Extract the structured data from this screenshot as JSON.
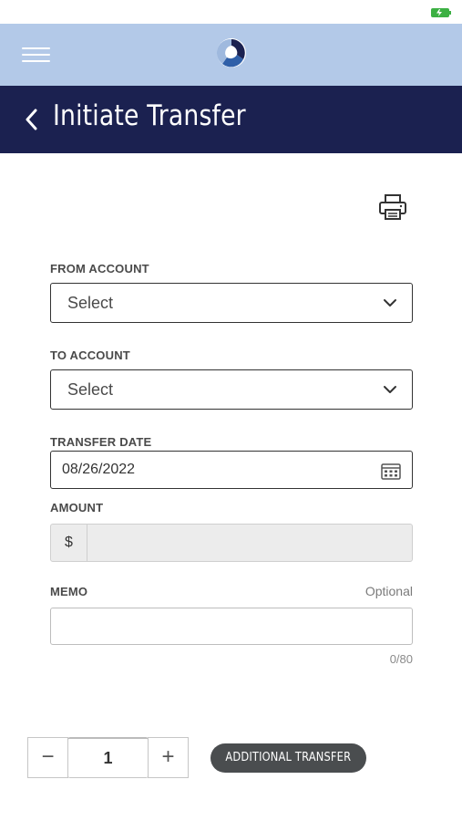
{
  "status_bar": {
    "battery_icon": "battery-icon",
    "accent_color": "#3cb043"
  },
  "app_bar": {
    "menu_icon": "hamburger-menu-icon",
    "logo_icon": "app-logo-icon",
    "background": "#b3c9e8"
  },
  "header": {
    "title": "Initiate Transfer",
    "back_icon": "chevron-left-icon",
    "background": "#1b2150"
  },
  "toolbar": {
    "print_icon": "printer-icon"
  },
  "form": {
    "from_account": {
      "label": "FROM ACCOUNT",
      "value": "Select"
    },
    "to_account": {
      "label": "TO ACCOUNT",
      "value": "Select"
    },
    "transfer_date": {
      "label": "TRANSFER DATE",
      "value": "08/26/2022",
      "icon": "calendar-icon"
    },
    "amount": {
      "label": "AMOUNT",
      "prefix": "$",
      "value": ""
    },
    "memo": {
      "label": "MEMO",
      "optional_text": "Optional",
      "value": "",
      "char_count": "0/80"
    }
  },
  "footer": {
    "stepper": {
      "minus": "−",
      "value": "1",
      "plus": "+"
    },
    "additional_transfer_label": "ADDITIONAL TRANSFER",
    "button_color": "#4a4d4f"
  }
}
